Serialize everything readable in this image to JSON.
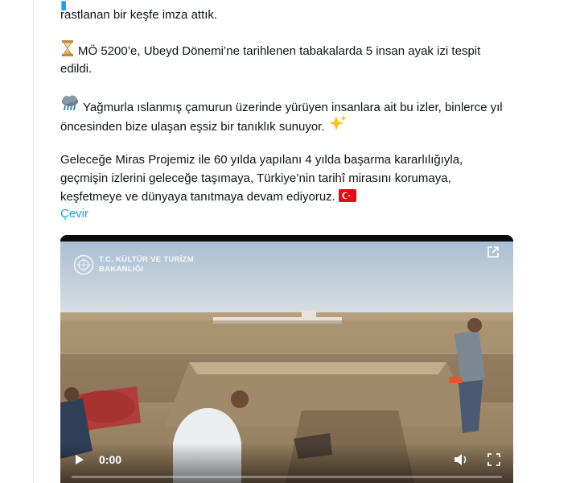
{
  "post": {
    "line_top_partial": "rastlanan bir keşfe imza attık.",
    "para_date_line1": "MÖ 5200’e, Ubeyd Dönemi’ne tarihlenen tabakalarda 5 insan ayak izi tespit",
    "para_date_line2": "edildi.",
    "para_rain_line1": "Yağmurla ıslanmış çamurun üzerinde yürüyen insanlara ait bu izler, binlerce yıl",
    "para_rain_line2": "öncesinden bize ulaşan eşsiz bir tanıklık sunuyor.",
    "para_future_line1": "Geleceğe Miras Projemiz ile 60 yılda yapılanı 4 yılda başarma kararlılığıyla,",
    "para_future_line2": "geçmişin izlerini geleceğe taşımaya, Türkiye’nin tarihî mirasını korumaya,",
    "para_future_line3": "keşfetmeye ve dünyaya tanıtmaya devam ediyoruz.",
    "translate_label": "Çevir"
  },
  "icons": {
    "hourglass": "hourglass-icon",
    "rain": "rain-cloud-icon",
    "sparkles": "sparkles-icon",
    "flag": "turkey-flag-icon",
    "play": "play-icon",
    "volume": "volume-icon",
    "fullscreen": "fullscreen-icon",
    "expand": "expand-icon"
  },
  "video": {
    "logo_line1": "T.C. KÜLTÜR VE TURİZM",
    "logo_line2": "BAKANLIĞI",
    "time": "0:00",
    "progress": 0
  },
  "colors": {
    "link": "#1d9bf0",
    "text": "#0f1419"
  }
}
